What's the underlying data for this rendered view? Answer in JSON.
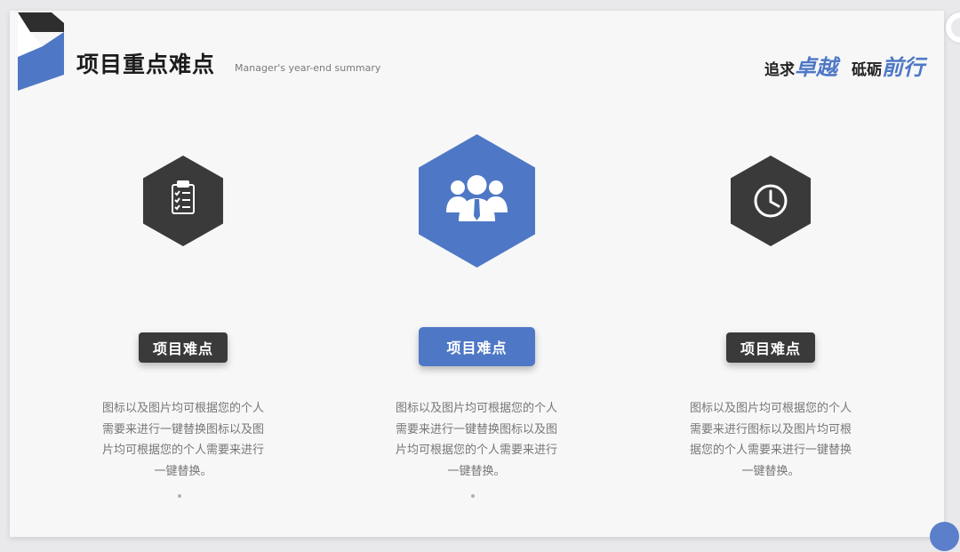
{
  "header": {
    "title": "项目重点难点",
    "subtitle": "Manager's year-end summary",
    "slogan": [
      {
        "plain": "追求",
        "accent": "卓越"
      },
      {
        "plain": "砥砺",
        "accent": "前行"
      }
    ]
  },
  "colors": {
    "accent": "#4e78c5",
    "dark": "#3a3a3a",
    "text": "#777777"
  },
  "cards": [
    {
      "icon": "clipboard-checklist-icon",
      "label": "项目难点",
      "description": "图标以及图片均可根据您的个人需要来进行一键替换图标以及图片均可根据您的个人需要来进行一键替换。",
      "dot": "。"
    },
    {
      "icon": "team-users-icon",
      "label": "项目难点",
      "description": "图标以及图片均可根据您的个人需要来进行一键替换图标以及图片均可根据您的个人需要来进行一键替换。",
      "dot": "。"
    },
    {
      "icon": "clock-icon",
      "label": "项目难点",
      "description": "图标以及图片均可根据您的个人需要来进行图标以及图片均可根据您的个人需要来进行一键替换一键替换。"
    }
  ]
}
